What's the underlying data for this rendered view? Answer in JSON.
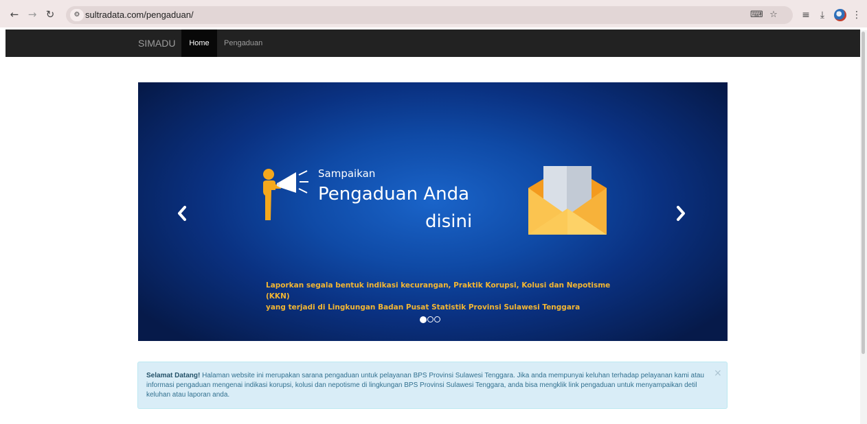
{
  "browser": {
    "url": "sultradata.com/pengaduan/",
    "icons": [
      "back-icon",
      "forward-icon",
      "reload-icon",
      "site-info-icon",
      "translate-icon",
      "bookmark-star-icon",
      "reading-list-icon",
      "download-icon",
      "profile-avatar",
      "menu-icon"
    ]
  },
  "navbar": {
    "brand": "SIMADU",
    "items": [
      {
        "label": "Home",
        "active": true
      },
      {
        "label": "Pengaduan",
        "active": false
      }
    ]
  },
  "carousel": {
    "caption_small": "Sampaikan",
    "caption_big": "Pengaduan Anda",
    "caption_tail": "disini",
    "description_line1": "Laporkan segala bentuk indikasi kecurangan, Praktik Korupsi, Kolusi dan Nepotisme (KKN)",
    "description_line2": "yang terjadi di Lingkungan Badan Pusat Statistik Provinsi Sulawesi Tenggara",
    "slide_count": 3,
    "active_slide": 1,
    "colors": {
      "highlight": "#f3b632",
      "background_center": "#1a64c9",
      "background_edge": "#061a4a"
    }
  },
  "alert": {
    "title": "Selamat Datang!",
    "message": "Halaman website ini merupakan sarana pengaduan untuk pelayanan BPS Provinsi Sulawesi Tenggara. Jika anda mempunyai keluhan terhadap pelayanan kami atau informasi pengaduan mengenai indikasi korupsi, kolusi dan nepotisme di lingkungan BPS Provinsi Sulawesi Tenggara, anda bisa mengklik link pengaduan untuk menyampaikan detil keluhan atau laporan anda.",
    "close_label": "×",
    "colors": {
      "background": "#d9edf7",
      "text": "#31708f"
    }
  }
}
